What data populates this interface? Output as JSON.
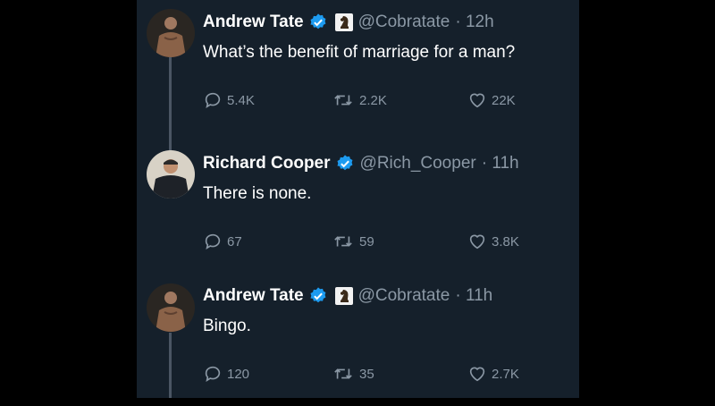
{
  "tweets": [
    {
      "author": "Andrew Tate",
      "handle": "@Cobratate",
      "time": "· 12h",
      "text": "What’s the benefit of marriage for a man?",
      "replies": "5.4K",
      "retweets": "2.2K",
      "likes": "22K",
      "has_badge_emoji": true
    },
    {
      "author": "Richard Cooper",
      "handle": "@Rich_Cooper",
      "time": "· 11h",
      "text": "There is none.",
      "replies": "67",
      "retweets": "59",
      "likes": "3.8K",
      "has_badge_emoji": false
    },
    {
      "author": "Andrew Tate",
      "handle": "@Cobratate",
      "time": "· 11h",
      "text": "Bingo.",
      "replies": "120",
      "retweets": "35",
      "likes": "2.7K",
      "has_badge_emoji": true
    }
  ],
  "colors": {
    "background": "#15202b",
    "text": "#ffffff",
    "muted": "#8b98a5",
    "verified": "#1d9bf0"
  }
}
